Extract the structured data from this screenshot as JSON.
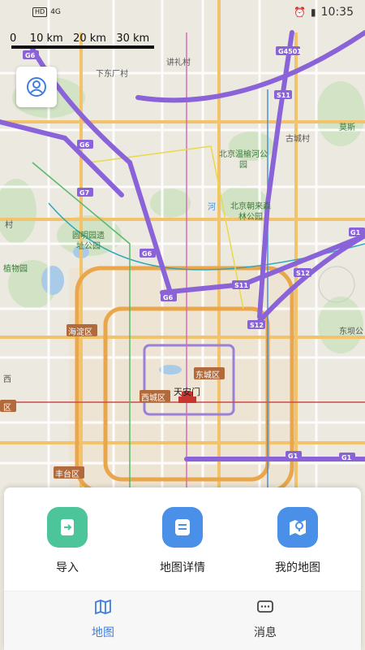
{
  "status_bar": {
    "network": "HD",
    "signal": "4G",
    "time": "10:35",
    "icons": [
      "alarm-icon",
      "battery-icon"
    ]
  },
  "map": {
    "scale_labels": "0    10 km   20 km   30 km",
    "labels": {
      "xiangshan": "下东厂村",
      "yanbeicun": "讲礼村",
      "gucheng": "古城村",
      "wenyu": "北京温榆河公园",
      "chaolai": "北京朝来森林公园",
      "yuanmingyuan": "圆明园遗址公园",
      "zhiwuyuan": "植物园",
      "haidian": "海淀区",
      "dongcheng": "东城区",
      "xicheng": "西城区",
      "tiananmen": "天安门",
      "fengtai": "丰台区",
      "chaoyang": "东坝公",
      "dongqu": "区",
      "moz": "莫斯",
      "cun": "村",
      "he": "河",
      "xi": "西"
    },
    "highways": [
      "G6",
      "G4501",
      "S11",
      "G6",
      "G7",
      "G6",
      "G6",
      "S11",
      "S12",
      "S12",
      "G1",
      "G1",
      "G1"
    ]
  },
  "bottom_sheet": {
    "actions": [
      {
        "label": "导入",
        "icon": "import-icon",
        "color": "#4cc59b"
      },
      {
        "label": "地图详情",
        "icon": "map-detail-icon",
        "color": "#4a90e8"
      },
      {
        "label": "我的地图",
        "icon": "my-map-icon",
        "color": "#4a90e8"
      }
    ],
    "tabs": [
      {
        "label": "地图",
        "icon": "map-tab-icon",
        "active": true,
        "color": "#3f7de0"
      },
      {
        "label": "消息",
        "icon": "message-tab-icon",
        "active": false
      }
    ]
  }
}
